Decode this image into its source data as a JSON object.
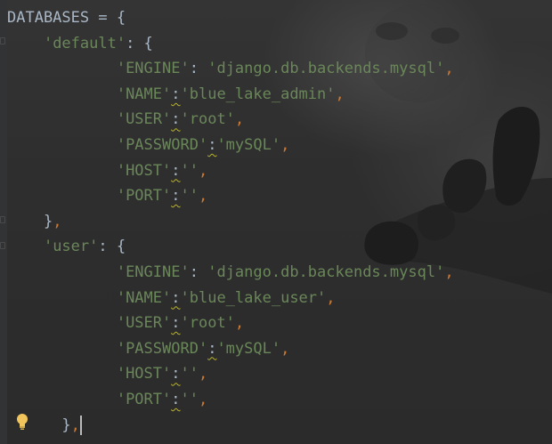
{
  "editor": {
    "lines": [
      {
        "indent": "",
        "tokens": [
          {
            "t": "DATABASES = {",
            "c": "plain"
          }
        ]
      },
      {
        "indent": "    ",
        "tokens": [
          {
            "t": "'default'",
            "c": "str"
          },
          {
            "t": ": {",
            "c": "plain"
          }
        ]
      },
      {
        "indent": "            ",
        "tokens": [
          {
            "t": "'ENGINE'",
            "c": "str"
          },
          {
            "t": ": ",
            "c": "plain"
          },
          {
            "t": "'django.db.backends.mysql'",
            "c": "str"
          },
          {
            "t": ",",
            "c": "punct"
          }
        ]
      },
      {
        "indent": "            ",
        "tokens": [
          {
            "t": "'NAME'",
            "c": "str"
          },
          {
            "t": ":",
            "c": "plain",
            "warn": true
          },
          {
            "t": "'blue_lake_admin'",
            "c": "str"
          },
          {
            "t": ",",
            "c": "punct"
          }
        ]
      },
      {
        "indent": "            ",
        "tokens": [
          {
            "t": "'USER'",
            "c": "str"
          },
          {
            "t": ":",
            "c": "plain",
            "warn": true
          },
          {
            "t": "'root'",
            "c": "str"
          },
          {
            "t": ",",
            "c": "punct"
          }
        ]
      },
      {
        "indent": "            ",
        "tokens": [
          {
            "t": "'PASSWORD'",
            "c": "str"
          },
          {
            "t": ":",
            "c": "plain",
            "warn": true
          },
          {
            "t": "'mySQL'",
            "c": "str"
          },
          {
            "t": ",",
            "c": "punct"
          }
        ]
      },
      {
        "indent": "            ",
        "tokens": [
          {
            "t": "'HOST'",
            "c": "str"
          },
          {
            "t": ":",
            "c": "plain",
            "warn": true
          },
          {
            "t": "''",
            "c": "str"
          },
          {
            "t": ",",
            "c": "punct"
          }
        ]
      },
      {
        "indent": "            ",
        "tokens": [
          {
            "t": "'PORT'",
            "c": "str"
          },
          {
            "t": ":",
            "c": "plain",
            "warn": true
          },
          {
            "t": "''",
            "c": "str"
          },
          {
            "t": ",",
            "c": "punct"
          }
        ]
      },
      {
        "indent": "    ",
        "tokens": [
          {
            "t": "}",
            "c": "plain"
          },
          {
            "t": ",",
            "c": "punct"
          }
        ]
      },
      {
        "indent": "    ",
        "tokens": [
          {
            "t": "'user'",
            "c": "str"
          },
          {
            "t": ": {",
            "c": "plain"
          }
        ]
      },
      {
        "indent": "            ",
        "tokens": [
          {
            "t": "'ENGINE'",
            "c": "str"
          },
          {
            "t": ": ",
            "c": "plain"
          },
          {
            "t": "'django.db.backends.mysql'",
            "c": "str"
          },
          {
            "t": ",",
            "c": "punct"
          }
        ]
      },
      {
        "indent": "            ",
        "tokens": [
          {
            "t": "'NAME'",
            "c": "str"
          },
          {
            "t": ":",
            "c": "plain",
            "warn": true
          },
          {
            "t": "'blue_lake_user'",
            "c": "str"
          },
          {
            "t": ",",
            "c": "punct"
          }
        ]
      },
      {
        "indent": "            ",
        "tokens": [
          {
            "t": "'USER'",
            "c": "str"
          },
          {
            "t": ":",
            "c": "plain",
            "warn": true
          },
          {
            "t": "'root'",
            "c": "str"
          },
          {
            "t": ",",
            "c": "punct"
          }
        ]
      },
      {
        "indent": "            ",
        "tokens": [
          {
            "t": "'PASSWORD'",
            "c": "str"
          },
          {
            "t": ":",
            "c": "plain",
            "warn": true
          },
          {
            "t": "'mySQL'",
            "c": "str"
          },
          {
            "t": ",",
            "c": "punct"
          }
        ]
      },
      {
        "indent": "            ",
        "tokens": [
          {
            "t": "'HOST'",
            "c": "str"
          },
          {
            "t": ":",
            "c": "plain",
            "warn": true
          },
          {
            "t": "''",
            "c": "str"
          },
          {
            "t": ",",
            "c": "punct"
          }
        ]
      },
      {
        "indent": "            ",
        "tokens": [
          {
            "t": "'PORT'",
            "c": "str"
          },
          {
            "t": ":",
            "c": "plain",
            "warn": true
          },
          {
            "t": "''",
            "c": "str"
          },
          {
            "t": ",",
            "c": "punct"
          }
        ]
      },
      {
        "indent": "      ",
        "tokens": [
          {
            "t": "}",
            "c": "plain"
          },
          {
            "t": ",",
            "c": "punct"
          }
        ],
        "caret": true
      }
    ]
  },
  "colors": {
    "background": "#2b2b2b",
    "string": "#6a8759",
    "punctuation": "#cc7832",
    "identifier": "#a9b7c6",
    "warning_underline": "#bbb529",
    "bulb": "#f2c55c"
  },
  "icons": {
    "intention_action": "lightbulb-icon"
  }
}
